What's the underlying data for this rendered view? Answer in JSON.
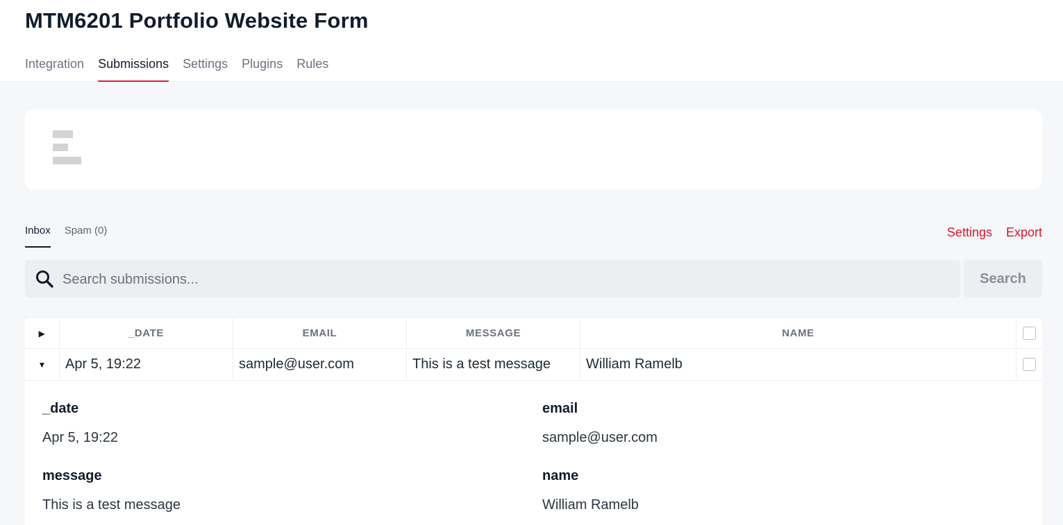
{
  "header": {
    "title": "MTM6201 Portfolio Website Form",
    "tabs": [
      {
        "label": "Integration",
        "active": false
      },
      {
        "label": "Submissions",
        "active": true
      },
      {
        "label": "Settings",
        "active": false
      },
      {
        "label": "Plugins",
        "active": false
      },
      {
        "label": "Rules",
        "active": false
      }
    ]
  },
  "mailbox": {
    "tabs": [
      {
        "label": "Inbox",
        "active": true
      },
      {
        "label": "Spam (0)",
        "active": false
      }
    ],
    "actions": {
      "settings_label": "Settings",
      "export_label": "Export"
    }
  },
  "search": {
    "placeholder": "Search submissions...",
    "value": "",
    "button_label": "Search",
    "icon": "search-icon"
  },
  "table": {
    "columns": [
      "_DATE",
      "EMAIL",
      "MESSAGE",
      "NAME"
    ],
    "rows": [
      {
        "date": "Apr 5, 19:22",
        "email": "sample@user.com",
        "message": "This is a test message",
        "name": "William Ramelb",
        "expanded": true
      }
    ],
    "detail": [
      {
        "label": "_date",
        "value": "Apr 5, 19:22"
      },
      {
        "label": "email",
        "value": "sample@user.com"
      },
      {
        "label": "message",
        "value": "This is a test message"
      },
      {
        "label": "name",
        "value": "William Ramelb"
      }
    ]
  },
  "colors": {
    "accent": "#e11d2e",
    "link": "#d9142b",
    "title": "#111c2b"
  }
}
